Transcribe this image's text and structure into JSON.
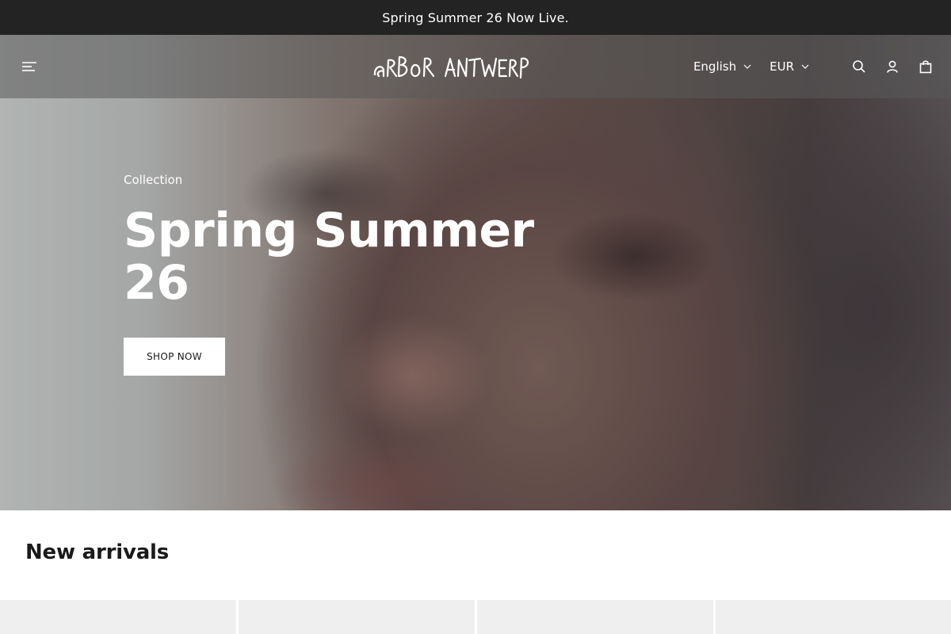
{
  "announcement": {
    "text": "Spring Summer 26 Now Live."
  },
  "header": {
    "logo_text": "ARBOR ANTWERP",
    "language": "English",
    "currency": "EUR",
    "icons": [
      "menu-icon",
      "search-icon",
      "account-icon",
      "cart-icon"
    ]
  },
  "hero": {
    "eyebrow": "Collection",
    "title": "Spring Summer 26",
    "cta": "SHOP NOW"
  },
  "new_arrivals": {
    "title": "New arrivals",
    "product_count_visible": 4
  },
  "colors": {
    "announcement_bg": "#232323",
    "accent_text": "#ffffff",
    "card_bg": "#efefef"
  }
}
